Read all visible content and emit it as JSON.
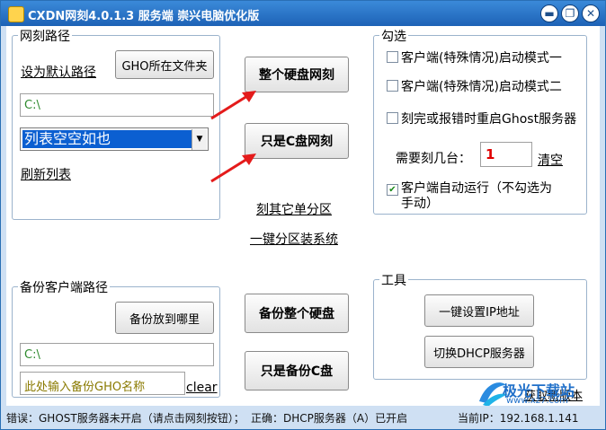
{
  "window": {
    "title": "CXDN网刻4.0.1.3 服务端 崇兴电脑优化版",
    "controls": {
      "minimize": "▬",
      "restore": "❐",
      "close": "✕"
    }
  },
  "path_group": {
    "label": "网刻路径",
    "set_default": "设为默认路径",
    "gho_folder_button": "GHO所在文件夹",
    "path_value": "C:\\",
    "list_selected": "列表空空如也",
    "refresh_list": "刷新列表"
  },
  "center": {
    "clone_whole_disk": "整个硬盘网刻",
    "clone_c_only": "只是C盘网刻",
    "clone_other_partition": "刻其它单分区",
    "one_key_partition": "一键分区装系统",
    "backup_whole_disk": "备份整个硬盘",
    "backup_c_only": "只是备份C盘"
  },
  "options_group": {
    "label": "勾选",
    "mode1": {
      "label": "客户端(特殊情况)启动模式一",
      "checked": false
    },
    "mode2": {
      "label": "客户端(特殊情况)启动模式二",
      "checked": false
    },
    "restart_ghost": {
      "label": "刻完或报错时重启Ghost服务器",
      "checked": false
    },
    "count_label": "需要刻几台：",
    "count_value": "1",
    "clear_link": "清空",
    "auto_run": {
      "label_line1": "客户端自动运行（不勾选为",
      "label_line2": "手动）",
      "checked": true
    }
  },
  "backup_group": {
    "label": "备份客户端路径",
    "where_button": "备份放到哪里",
    "path_value": "C:\\",
    "name_placeholder": "此处输入备份GHO名称",
    "clear_link": "clear"
  },
  "tools_group": {
    "label": "工具",
    "set_ip": "一键设置IP地址",
    "switch_dhcp": "切换DHCP服务器"
  },
  "get_new_version": "获取新版本",
  "status": {
    "error": "错误：GHOST服务器未开启（请点击网刻按钮）；",
    "ok": "正确：DHCP服务器（A）已开启",
    "ip": "当前IP：192.168.1.141"
  },
  "watermark": {
    "text": "极光下载站",
    "url": "www.xz7.com"
  },
  "colors": {
    "arrow": "#e41b1b",
    "count": "#e00000",
    "selection": "#0b5fd1",
    "path_text": "#2e8a2e"
  }
}
